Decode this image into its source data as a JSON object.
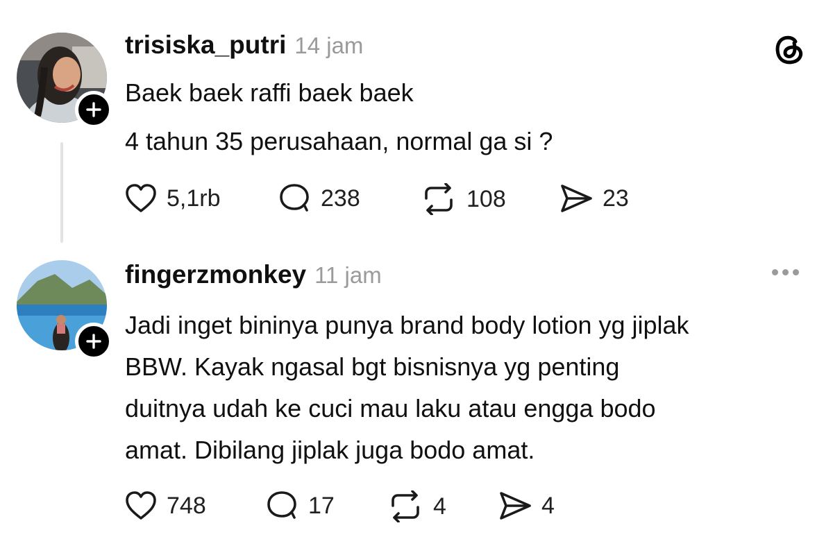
{
  "posts": [
    {
      "username": "trisiska_putri",
      "time": "14 jam",
      "lines": [
        "Baek baek raffi baek baek",
        "4 tahun 35 perusahaan, normal ga si ?"
      ],
      "likes": "5,1rb",
      "replies": "238",
      "reposts": "108",
      "shares": "23"
    },
    {
      "username": "fingerzmonkey",
      "time": "11 jam",
      "lines": [
        "Jadi inget bininya punya brand body lotion yg jiplak",
        "BBW. Kayak ngasal bgt bisnisnya yg penting",
        "duitnya udah ke cuci mau laku atau engga bodo",
        "amat. Dibilang jiplak juga bodo amat."
      ],
      "likes": "748",
      "replies": "17",
      "reposts": "4",
      "shares": "4"
    }
  ],
  "icons": {
    "app_logo": "threads-logo-icon",
    "more": "more-horizontal-icon",
    "like": "heart-icon",
    "reply": "comment-bubble-icon",
    "repost": "repost-icon",
    "share": "send-icon",
    "follow": "plus-icon"
  },
  "colors": {
    "text": "#101010",
    "muted": "#9a9a9a",
    "thread_line": "#e3e3e3"
  }
}
